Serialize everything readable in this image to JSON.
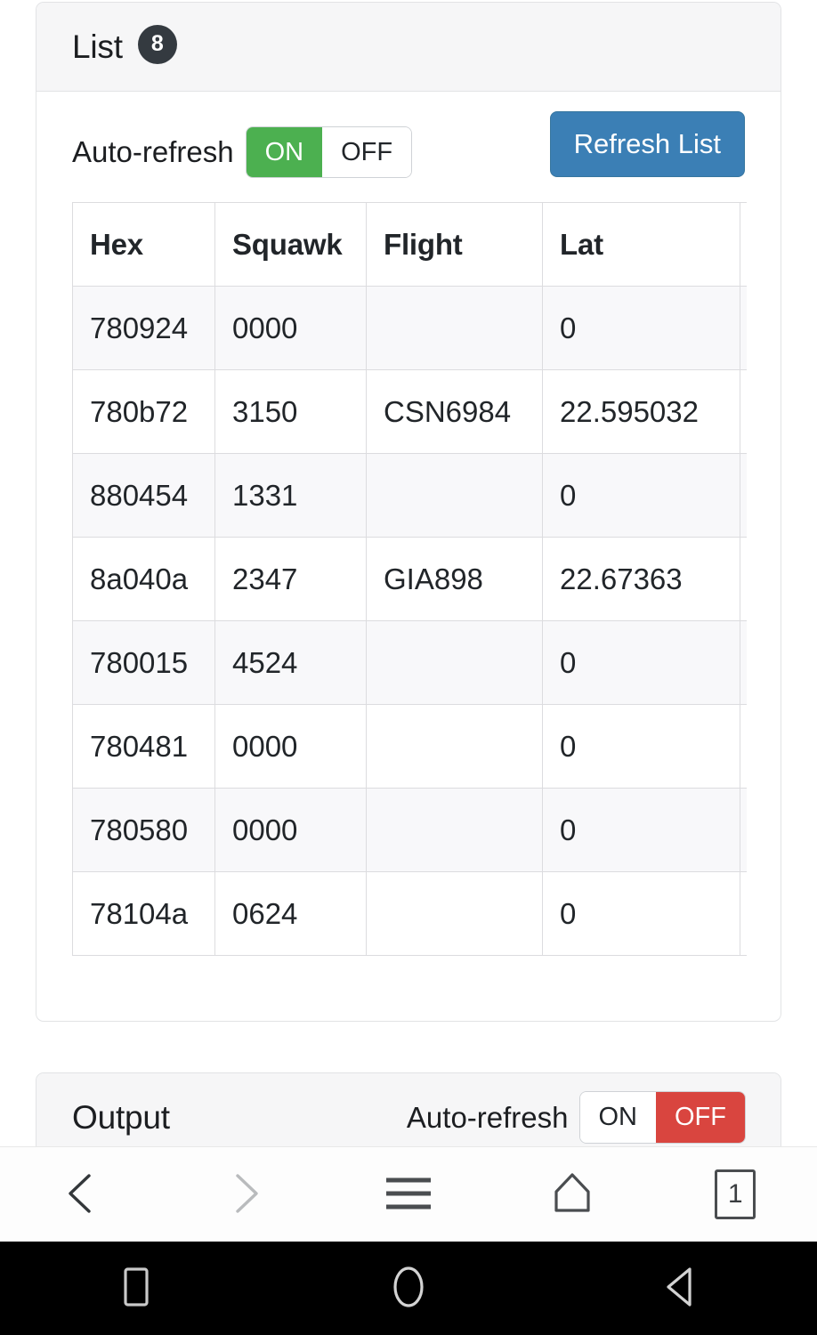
{
  "list_card": {
    "title": "List",
    "count": "8",
    "auto_refresh_label": "Auto-refresh",
    "toggle": {
      "on_label": "ON",
      "off_label": "OFF",
      "selected": "ON"
    },
    "refresh_button_label": "Refresh List",
    "table": {
      "columns": [
        "Hex",
        "Squawk",
        "Flight",
        "Lat",
        ""
      ],
      "rows": [
        [
          "780924",
          "0000",
          "",
          "0",
          ""
        ],
        [
          "780b72",
          "3150",
          "CSN6984",
          "22.595032",
          ""
        ],
        [
          "880454",
          "1331",
          "",
          "0",
          ""
        ],
        [
          "8a040a",
          "2347",
          "GIA898",
          "22.67363",
          ""
        ],
        [
          "780015",
          "4524",
          "",
          "0",
          ""
        ],
        [
          "780481",
          "0000",
          "",
          "0",
          ""
        ],
        [
          "780580",
          "0000",
          "",
          "0",
          ""
        ],
        [
          "78104a",
          "0624",
          "",
          "0",
          ""
        ]
      ]
    }
  },
  "output_card": {
    "title": "Output",
    "auto_refresh_label": "Auto-refresh",
    "toggle": {
      "on_label": "ON",
      "off_label": "OFF",
      "selected": "OFF"
    }
  },
  "browser_nav": {
    "back_icon": "chevron-left-icon",
    "forward_icon": "chevron-right-icon",
    "menu_icon": "hamburger-menu-icon",
    "home_icon": "home-icon",
    "tabs_icon": "tab-count-icon",
    "tab_count": "1"
  },
  "system_bar": {
    "recents_icon": "square-recents-icon",
    "home_icon": "circle-home-icon",
    "back_icon": "triangle-back-icon"
  },
  "colors": {
    "accent_blue": "#3b7fb5",
    "on_green": "#4cb050",
    "off_red": "#d9453f",
    "badge_dark": "#343a40",
    "card_header_bg": "#f6f6f7",
    "row_stripe": "#f8f8fa"
  }
}
